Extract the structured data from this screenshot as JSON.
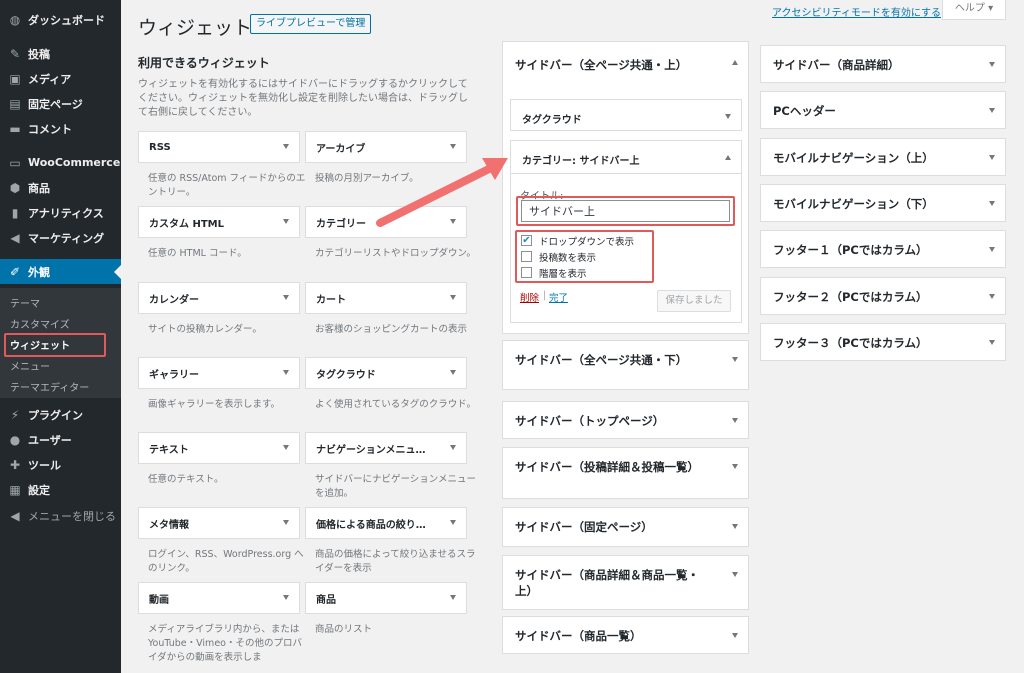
{
  "menu": {
    "dashboard": "ダッシュボード",
    "posts": "投稿",
    "media": "メディア",
    "pages": "固定ページ",
    "comments": "コメント",
    "woocommerce": "WooCommerce",
    "products": "商品",
    "analytics": "アナリティクス",
    "marketing": "マーケティング",
    "appearance": "外観",
    "sub": {
      "themes": "テーマ",
      "customize": "カスタマイズ",
      "widgets": "ウィジェット",
      "menus": "メニュー",
      "theme_editor": "テーマエディター"
    },
    "plugins": "プラグイン",
    "users": "ユーザー",
    "tools": "ツール",
    "settings": "設定",
    "collapse": "メニューを閉じる"
  },
  "header": {
    "title": "ウィジェット",
    "live_preview": "ライブプレビューで管理",
    "a11y": "アクセシビリティモードを有効にする",
    "help": "ヘルプ ▾"
  },
  "available": {
    "title": "利用できるウィジェット",
    "description": "ウィジェットを有効化するにはサイドバーにドラッグするかクリックしてください。ウィジェットを無効化し設定を削除したい場合は、ドラッグして右側に戻してください。",
    "widgets": [
      {
        "name": "RSS",
        "desc": "任意の RSS/Atom フィードからのエントリー。"
      },
      {
        "name": "アーカイブ",
        "desc": "投稿の月別アーカイブ。"
      },
      {
        "name": "カスタム HTML",
        "desc": "任意の HTML コード。"
      },
      {
        "name": "カテゴリー",
        "desc": "カテゴリーリストやドロップダウン。"
      },
      {
        "name": "カレンダー",
        "desc": "サイトの投稿カレンダー。"
      },
      {
        "name": "カート",
        "desc": "お客様のショッピングカートの表示"
      },
      {
        "name": "ギャラリー",
        "desc": "画像ギャラリーを表示します。"
      },
      {
        "name": "タグクラウド",
        "desc": "よく使用されているタグのクラウド。"
      },
      {
        "name": "テキスト",
        "desc": "任意のテキスト。"
      },
      {
        "name": "ナビゲーションメニュ…",
        "desc": "サイドバーにナビゲーションメニューを追加。"
      },
      {
        "name": "メタ情報",
        "desc": "ログイン、RSS、WordPress.org へのリンク。"
      },
      {
        "name": "価格による商品の絞り…",
        "desc": "商品の価格によって絞り込ませるスライダーを表示"
      },
      {
        "name": "動画",
        "desc": "メディアライブラリ内から、または YouTube・Vimeo・その他のプロバイダからの動画を表示しま"
      },
      {
        "name": "商品",
        "desc": "商品のリスト"
      }
    ]
  },
  "areas": {
    "top": {
      "title": "サイドバー（全ページ共通・上）",
      "tagcloud": "タグクラウド",
      "category": {
        "header": "カテゴリー: サイドバー上",
        "title_label": "タイトル:",
        "title_value": "サイドバー上",
        "opt1": "ドロップダウンで表示",
        "opt2": "投稿数を表示",
        "opt3": "階層を表示",
        "delete": "削除",
        "sep": "|",
        "done": "完了",
        "saved": "保存しました"
      }
    },
    "col1": [
      "サイドバー（全ページ共通・下）",
      "サイドバー（トップページ）",
      "サイドバー（投稿詳細＆投稿一覧）",
      "サイドバー（固定ページ）",
      "サイドバー（商品詳細＆商品一覧・上）",
      "サイドバー（商品一覧）"
    ],
    "col2": [
      "サイドバー（商品詳細）",
      "PCヘッダー",
      "モバイルナビゲーション（上）",
      "モバイルナビゲーション（下）",
      "フッター１（PCではカラム）",
      "フッター２（PCではカラム）",
      "フッター３（PCではカラム）"
    ]
  },
  "colors": {
    "sidebar_bg": "#23282d",
    "accent": "#0073aa",
    "highlight": "#e05a5a"
  }
}
